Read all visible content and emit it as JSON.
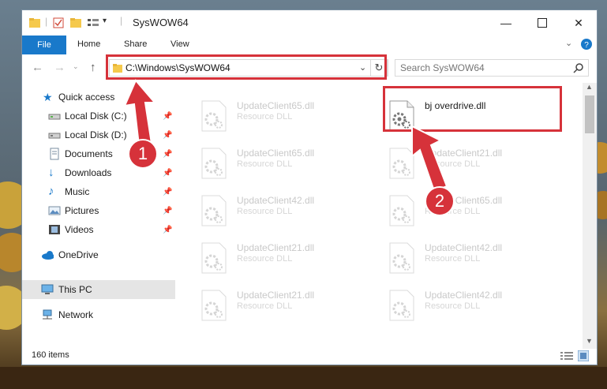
{
  "window": {
    "title": "SysWOW64",
    "minimize_icon": "minimize-icon",
    "maximize_icon": "maximize-icon",
    "close_icon": "close-icon"
  },
  "ribbon": {
    "tabs": [
      "File",
      "Home",
      "Share",
      "View"
    ]
  },
  "navigation": {
    "address": "C:\\Windows\\SysWOW64",
    "search_placeholder": "Search SysWOW64"
  },
  "sidebar": {
    "items": [
      {
        "label": "Quick access",
        "icon": "star-icon"
      },
      {
        "label": "Local Disk (C:)",
        "icon": "drive-icon",
        "pinned": true
      },
      {
        "label": "Local Disk (D:)",
        "icon": "drive-icon",
        "pinned": true
      },
      {
        "label": "Documents",
        "icon": "documents-icon",
        "pinned": true
      },
      {
        "label": "Downloads",
        "icon": "download-icon",
        "pinned": true
      },
      {
        "label": "Music",
        "icon": "music-icon",
        "pinned": true
      },
      {
        "label": "Pictures",
        "icon": "pictures-icon",
        "pinned": true
      },
      {
        "label": "Videos",
        "icon": "videos-icon",
        "pinned": true
      },
      {
        "label": "OneDrive",
        "icon": "cloud-icon"
      },
      {
        "label": "This PC",
        "icon": "computer-icon",
        "selected": true
      },
      {
        "label": "Network",
        "icon": "network-icon"
      }
    ]
  },
  "files": {
    "left": [
      {
        "name": "UpdateClient65.dll",
        "type": "Resource DLL"
      },
      {
        "name": "UpdateClient65.dll",
        "type": "Resource DLL"
      },
      {
        "name": "UpdateClient42.dll",
        "type": "Resource DLL"
      },
      {
        "name": "UpdateClient21.dll",
        "type": "Resource DLL"
      },
      {
        "name": "UpdateClient21.dll",
        "type": "Resource DLL"
      }
    ],
    "right": [
      {
        "name": "bj overdrive.dll",
        "type": ""
      },
      {
        "name": "UpdateClient21.dll",
        "type": "Resource DLL"
      },
      {
        "name": "UpdateClient65.dll",
        "type": "Resource DLL"
      },
      {
        "name": "UpdateClient42.dll",
        "type": "Resource DLL"
      },
      {
        "name": "UpdateClient42.dll",
        "type": "Resource DLL"
      }
    ]
  },
  "status": {
    "item_count": "160 items"
  },
  "annotations": {
    "badge1": "1",
    "badge2": "2",
    "color": "#d6323a"
  }
}
